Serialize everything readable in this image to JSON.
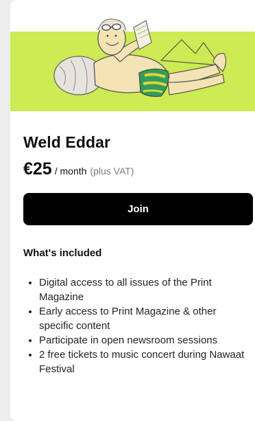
{
  "plan": {
    "name": "Weld Eddar",
    "price": "€25",
    "period": "/ month",
    "tax_note": "(plus VAT)",
    "join_label": "Join"
  },
  "included": {
    "heading": "What's included",
    "items": [
      "Digital access to all issues of the Print Magazine",
      "Early access to Print Magazine & other specific content",
      "Participate in open newsroom sessions",
      "2 free tickets to music concert during Nawaat Festival"
    ]
  },
  "colors": {
    "page_bg": "#ededed",
    "card_bg": "#ffffff",
    "hero_bg": "#cdeb52",
    "button_bg": "#000000",
    "button_text": "#ffffff",
    "muted_text": "#7a7a7a"
  }
}
